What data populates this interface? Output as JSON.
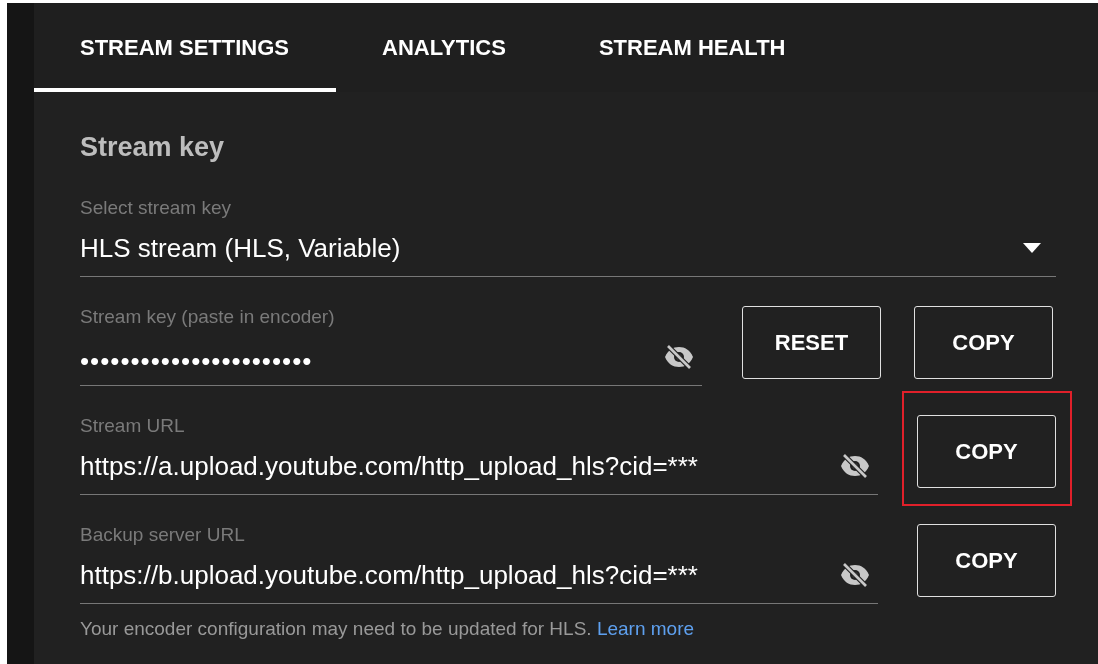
{
  "tabs": [
    {
      "label": "STREAM SETTINGS",
      "selected": true
    },
    {
      "label": "ANALYTICS",
      "selected": false
    },
    {
      "label": "STREAM HEALTH",
      "selected": false
    }
  ],
  "section_title": "Stream key",
  "select_stream_key": {
    "label": "Select stream key",
    "value": "HLS stream (HLS, Variable)"
  },
  "fields": [
    {
      "kind": "key",
      "label": "Stream key (paste in encoder)",
      "value": "•••••••••••••••••••••••",
      "hidden": true,
      "buttons": [
        {
          "label": "RESET",
          "highlighted": false
        },
        {
          "label": "COPY",
          "highlighted": false
        }
      ]
    },
    {
      "kind": "url",
      "label": "Stream URL",
      "value": "https://a.upload.youtube.com/http_upload_hls?cid=***",
      "hidden": true,
      "buttons": [
        {
          "label": "COPY",
          "highlighted": true
        }
      ]
    },
    {
      "kind": "url",
      "label": "Backup server URL",
      "value": "https://b.upload.youtube.com/http_upload_hls?cid=***",
      "hidden": true,
      "buttons": [
        {
          "label": "COPY",
          "highlighted": false
        }
      ]
    }
  ],
  "helper_text": "Your encoder configuration may need to be updated for HLS.",
  "helper_link": "Learn more"
}
